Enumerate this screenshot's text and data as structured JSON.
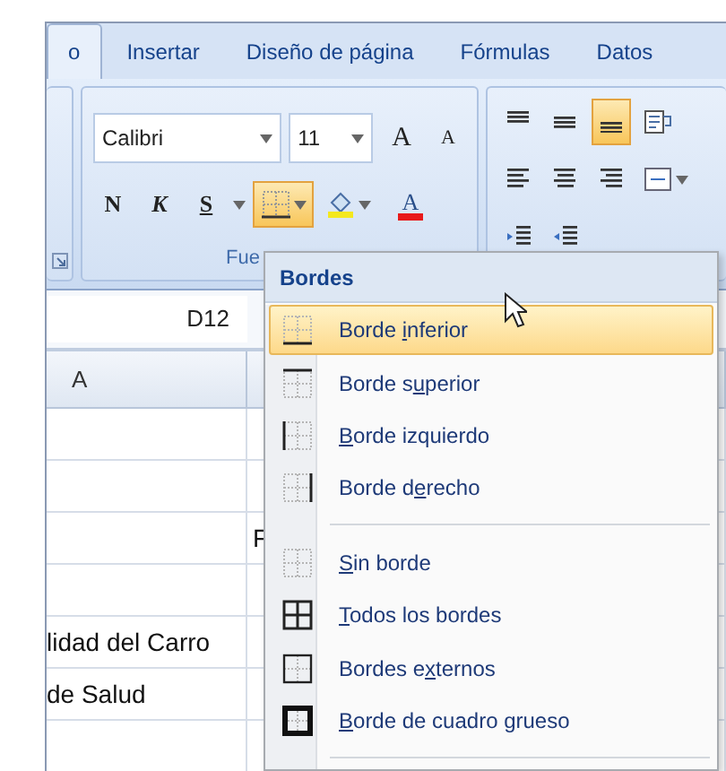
{
  "tabs": [
    {
      "label": "o",
      "selected": true
    },
    {
      "label": "Insertar",
      "selected": false
    },
    {
      "label": "Diseño de página",
      "selected": false
    },
    {
      "label": "Fórmulas",
      "selected": false
    },
    {
      "label": "Datos",
      "selected": false
    }
  ],
  "font_group": {
    "font": "Calibri",
    "size": "11",
    "grow": "A",
    "shrink": "A",
    "bold": "N",
    "italic": "K",
    "underline": "S",
    "border_pressed": true,
    "font_color": "A",
    "label": "Fue"
  },
  "vertical_align": [
    {
      "selected": false
    },
    {
      "selected": false
    },
    {
      "selected": true
    }
  ],
  "name_box": "D12",
  "columns": [
    "A"
  ],
  "rows": [
    {},
    {},
    {
      "b": "F"
    },
    {},
    {
      "a": "lidad del Carro"
    },
    {
      "a": "de Salud"
    },
    {}
  ],
  "borders_menu": {
    "title": "Bordes",
    "items": [
      {
        "kind": "item",
        "start": "Borde ",
        "key": "i",
        "end": "nferior",
        "selected": true
      },
      {
        "kind": "item",
        "start": "Borde s",
        "key": "u",
        "end": "perior",
        "selected": false
      },
      {
        "kind": "item",
        "key": "B",
        "end": "orde izquierdo",
        "selected": false
      },
      {
        "kind": "item",
        "start": "Borde d",
        "key": "e",
        "end": "recho",
        "selected": false
      },
      {
        "kind": "separator"
      },
      {
        "kind": "item",
        "key": "S",
        "end": "in borde",
        "selected": false
      },
      {
        "kind": "item",
        "key": "T",
        "end": "odos los bordes",
        "selected": false
      },
      {
        "kind": "item",
        "start": "Bordes e",
        "key": "x",
        "end": "ternos",
        "selected": false
      },
      {
        "kind": "item",
        "key": "B",
        "end": "orde de cuadro grueso",
        "selected": false
      },
      {
        "kind": "separator"
      }
    ]
  }
}
